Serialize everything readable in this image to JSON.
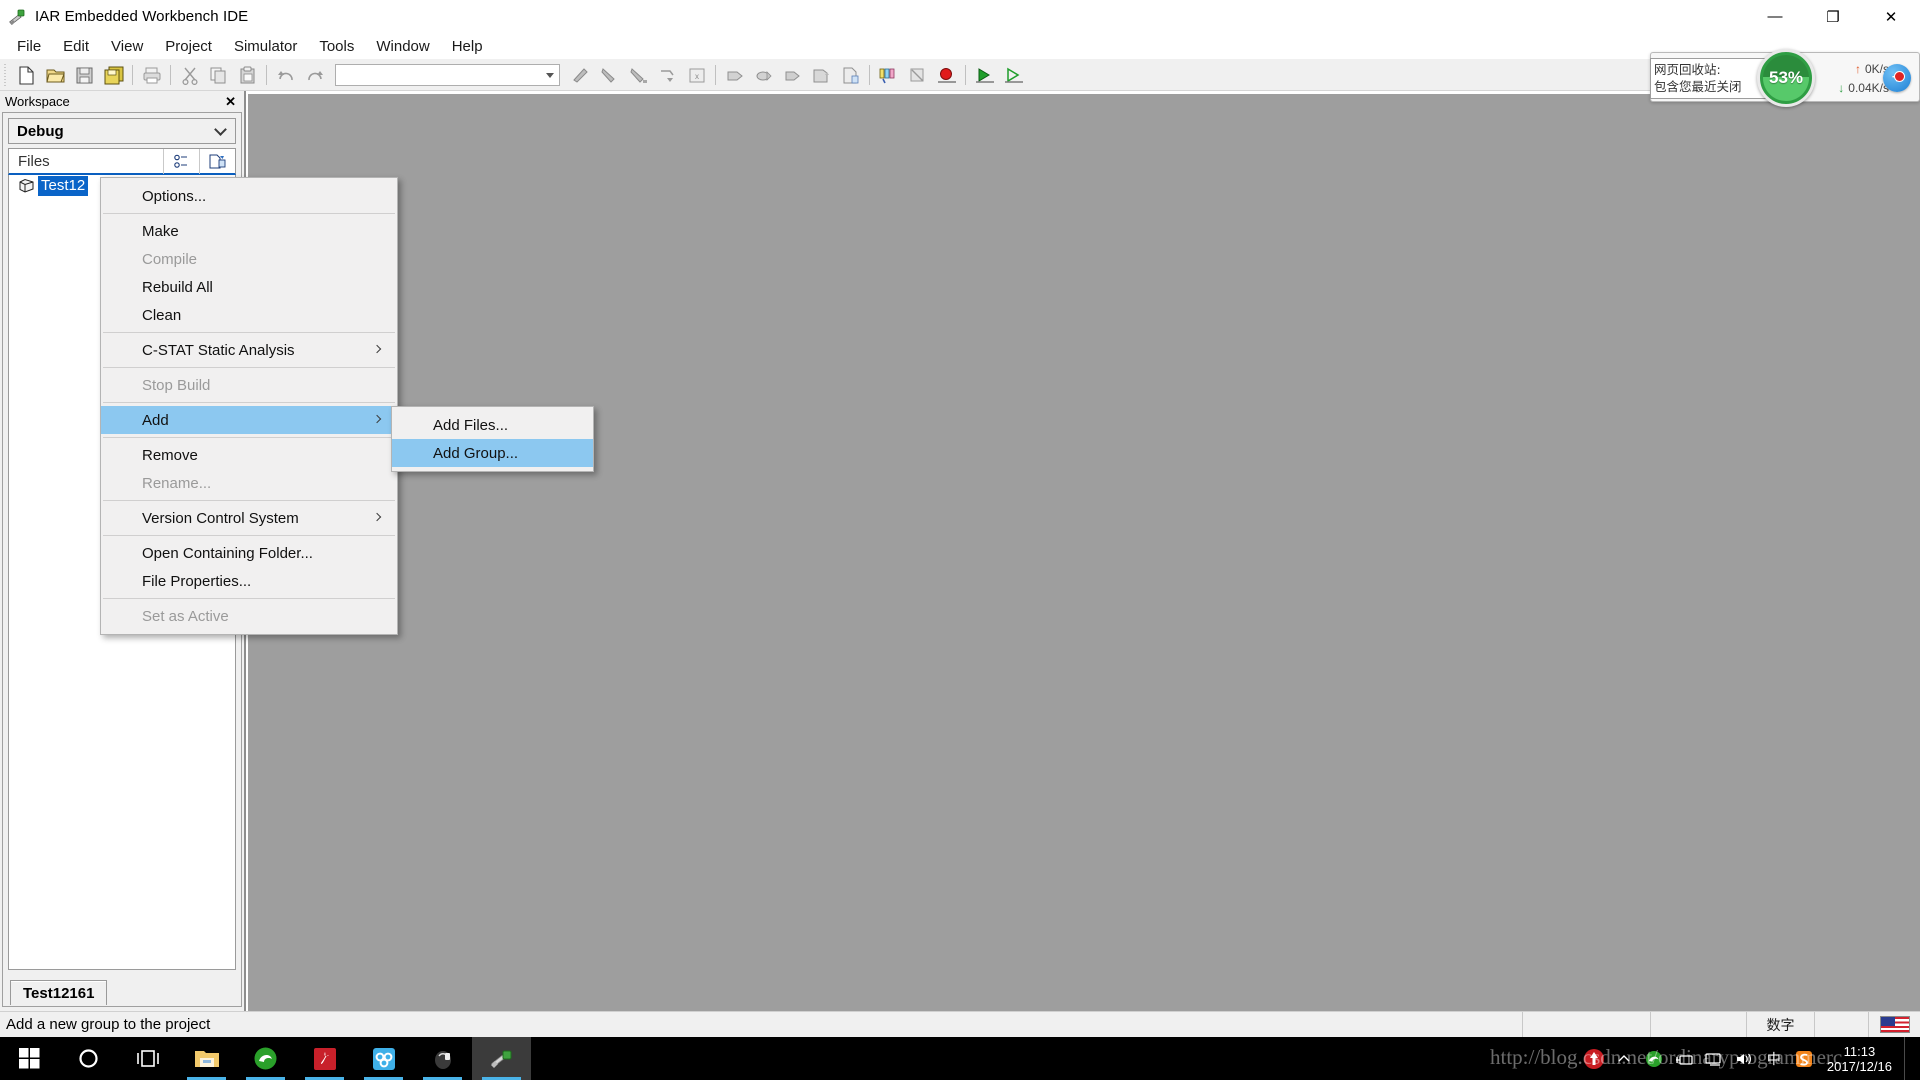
{
  "window": {
    "title": "IAR Embedded Workbench IDE",
    "app_icon": "iar-app-icon",
    "minimize": "—",
    "restore": "❐",
    "close": "✕"
  },
  "menubar": {
    "items": [
      {
        "label": "File"
      },
      {
        "label": "Edit"
      },
      {
        "label": "View"
      },
      {
        "label": "Project"
      },
      {
        "label": "Simulator"
      },
      {
        "label": "Tools"
      },
      {
        "label": "Window"
      },
      {
        "label": "Help"
      }
    ]
  },
  "toolbar": {
    "combo_value": "",
    "combo_placeholder": "",
    "buttons": [
      {
        "name": "new-document-icon"
      },
      {
        "name": "open-folder-icon"
      },
      {
        "name": "save-icon"
      },
      {
        "name": "save-all-icon"
      },
      {
        "name": "print-icon"
      },
      {
        "name": "cut-icon"
      },
      {
        "name": "copy-icon"
      },
      {
        "name": "paste-icon"
      },
      {
        "name": "undo-icon"
      },
      {
        "name": "redo-icon"
      }
    ],
    "debug_buttons": [
      {
        "name": "find-icon"
      },
      {
        "name": "find-next-icon"
      },
      {
        "name": "find-previous-icon"
      },
      {
        "name": "goto-icon"
      },
      {
        "name": "toggle-bookmark-icon"
      },
      {
        "name": "navigate-backward-icon"
      },
      {
        "name": "navigate-forward-icon"
      },
      {
        "name": "step-icon"
      },
      {
        "name": "compile-icon"
      },
      {
        "name": "make-icon"
      },
      {
        "name": "build-all-icon"
      },
      {
        "name": "stop-build-icon"
      },
      {
        "name": "toggle-breakpoint-icon"
      },
      {
        "name": "download-and-debug-icon"
      },
      {
        "name": "debug-without-download-icon"
      }
    ]
  },
  "workspace": {
    "caption": "Workspace",
    "close_label": "✕",
    "configuration": "Debug",
    "files_header": "Files",
    "header_buttons": [
      {
        "name": "expand-collapse-icon"
      },
      {
        "name": "make-icon-small"
      }
    ],
    "tree": [
      {
        "label": "Test12",
        "icon": "project-cube-icon",
        "selected": true
      }
    ],
    "tab": "Test12161"
  },
  "context_menu": {
    "items": [
      {
        "label": "Options...",
        "enabled": true,
        "submenu": false,
        "selected": false
      },
      {
        "separator": true
      },
      {
        "label": "Make",
        "enabled": true,
        "submenu": false,
        "selected": false
      },
      {
        "label": "Compile",
        "enabled": false,
        "submenu": false,
        "selected": false
      },
      {
        "label": "Rebuild All",
        "enabled": true,
        "submenu": false,
        "selected": false
      },
      {
        "label": "Clean",
        "enabled": true,
        "submenu": false,
        "selected": false
      },
      {
        "separator": true
      },
      {
        "label": "C-STAT Static Analysis",
        "enabled": true,
        "submenu": true,
        "selected": false
      },
      {
        "separator": true
      },
      {
        "label": "Stop Build",
        "enabled": false,
        "submenu": false,
        "selected": false
      },
      {
        "separator": true
      },
      {
        "label": "Add",
        "enabled": true,
        "submenu": true,
        "selected": true
      },
      {
        "separator": true
      },
      {
        "label": "Remove",
        "enabled": true,
        "submenu": false,
        "selected": false
      },
      {
        "label": "Rename...",
        "enabled": false,
        "submenu": false,
        "selected": false
      },
      {
        "separator": true
      },
      {
        "label": "Version Control System",
        "enabled": true,
        "submenu": true,
        "selected": false
      },
      {
        "separator": true
      },
      {
        "label": "Open Containing Folder...",
        "enabled": true,
        "submenu": false,
        "selected": false
      },
      {
        "label": "File Properties...",
        "enabled": true,
        "submenu": false,
        "selected": false
      },
      {
        "separator": true
      },
      {
        "label": "Set as Active",
        "enabled": false,
        "submenu": false,
        "selected": false
      }
    ]
  },
  "submenu": {
    "items": [
      {
        "label": "Add Files...",
        "selected": false
      },
      {
        "label": "Add Group...",
        "selected": true
      }
    ]
  },
  "network_widget": {
    "tooltip_line1": "网页回收站:",
    "tooltip_line2": "包含您最近关闭",
    "percent": "53%",
    "upload": "0K/s",
    "download": "0.04K/s",
    "upload_arrow": "↑",
    "download_arrow": "↓",
    "plus_label": "+",
    "accent_green": "#2f9e44",
    "accent_blue": "#1d7fd4",
    "badge_red": "#e02424"
  },
  "statusbar": {
    "message": "Add a new group to the project",
    "cells": [
      "",
      "",
      "数字",
      ""
    ],
    "flag_name": "us-flag-icon"
  },
  "taskbar": {
    "items": [
      {
        "name": "start-button",
        "glyph": "⊞",
        "active": false,
        "running": false
      },
      {
        "name": "cortana-search-button",
        "glyph": "○",
        "active": false,
        "running": false
      },
      {
        "name": "task-view-button",
        "glyph": "❑",
        "active": false,
        "running": false
      },
      {
        "name": "file-explorer-button",
        "glyph": "",
        "active": false,
        "running": true
      },
      {
        "name": "edge-browser-button",
        "glyph": "e",
        "active": false,
        "running": true
      },
      {
        "name": "adobe-reader-button",
        "glyph": "A",
        "active": false,
        "running": true
      },
      {
        "name": "baidu-netdisk-button",
        "glyph": "",
        "active": false,
        "running": true
      },
      {
        "name": "media-app-button",
        "glyph": "",
        "active": false,
        "running": true
      },
      {
        "name": "iar-workbench-button",
        "glyph": "",
        "active": true,
        "running": true
      }
    ],
    "tray": [
      {
        "name": "baidu-tray-icon",
        "glyph": "●"
      },
      {
        "name": "show-hidden-icons",
        "glyph": "∧"
      },
      {
        "name": "edge-tray-icon",
        "glyph": "e"
      },
      {
        "name": "usb-device-icon",
        "glyph": "⌨"
      },
      {
        "name": "network-icon",
        "glyph": "□"
      },
      {
        "name": "volume-icon",
        "glyph": "🔊"
      },
      {
        "name": "ime-mode-icon",
        "glyph": "中"
      },
      {
        "name": "sogou-input-icon",
        "glyph": "S"
      }
    ],
    "clock_time": "11:13",
    "clock_date": "2017/12/16",
    "watermark": "http://blog.csdn.net/ordinaryprogrammerc"
  }
}
